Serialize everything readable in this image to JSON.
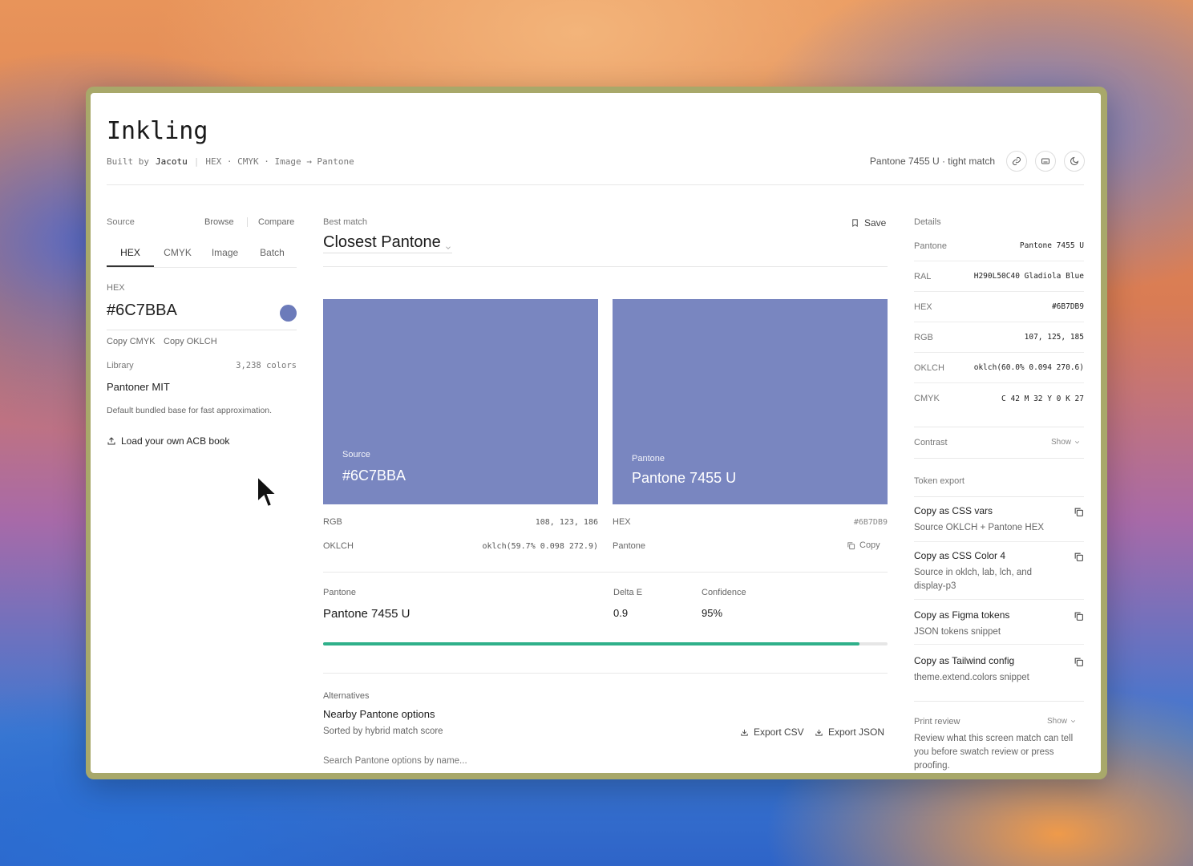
{
  "app": {
    "title": "Inkling",
    "built_by": "Built by",
    "author": "Jacotu",
    "breadcrumb": "HEX · CMYK · Image → Pantone"
  },
  "header": {
    "status": "Pantone 7455 U · tight match",
    "icons": [
      "link-icon",
      "keyboard-icon",
      "moon-icon"
    ]
  },
  "source": {
    "label": "Source",
    "browse": "Browse",
    "compare": "Compare",
    "tabs": [
      "HEX",
      "CMYK",
      "Image",
      "Batch"
    ],
    "hex_label": "HEX",
    "hex_value": "#6C7BBA",
    "hex_color": "#6C7BBA",
    "copy_cmyk": "Copy CMYK",
    "copy_oklch": "Copy OKLCH",
    "library_label": "Library",
    "library_count": "3,238 colors",
    "library_name": "Pantoner MIT",
    "library_desc": "Default bundled base for fast approximation.",
    "load_acb": "Load your own ACB book"
  },
  "match": {
    "best_label": "Best match",
    "heading": "Closest Pantone",
    "save": "Save",
    "source_swatch": {
      "label": "Source",
      "value": "#6C7BBA",
      "color": "#7986C0"
    },
    "pantone_swatch": {
      "label": "Pantone",
      "value": "Pantone 7455 U",
      "color": "#7986C0"
    },
    "rgb_label": "RGB",
    "rgb_value": "108, 123, 186",
    "oklch_label": "OKLCH",
    "oklch_value": "oklch(59.7% 0.098 272.9)",
    "hex_label": "HEX",
    "hex_value": "#6B7DB9",
    "pantone_label": "Pantone",
    "copy": "Copy",
    "result_pantone_label": "Pantone",
    "result_pantone": "Pantone 7455 U",
    "delta_label": "Delta E",
    "delta_value": "0.9",
    "confidence_label": "Confidence",
    "confidence_value": "95%",
    "confidence_fraction": 0.95,
    "bar_color": "#2fb08a",
    "alt_label": "Alternatives",
    "alt_title": "Nearby Pantone options",
    "alt_sub": "Sorted by hybrid match score",
    "export_csv": "Export CSV",
    "export_json": "Export JSON",
    "search_placeholder": "Search Pantone options by name..."
  },
  "details": {
    "label": "Details",
    "rows": [
      {
        "k": "Pantone",
        "v": "Pantone 7455 U"
      },
      {
        "k": "RAL",
        "v": "H290L50C40 Gladiola Blue"
      },
      {
        "k": "HEX",
        "v": "#6B7DB9"
      },
      {
        "k": "RGB",
        "v": "107, 125, 185"
      },
      {
        "k": "OKLCH",
        "v": "oklch(60.0% 0.094 270.6)"
      },
      {
        "k": "CMYK",
        "v": "C 42 M 32 Y 0 K 27"
      }
    ],
    "contrast_label": "Contrast",
    "contrast_show": "Show",
    "token_label": "Token export",
    "tokens": [
      {
        "t": "Copy as CSS vars",
        "d": "Source OKLCH + Pantone HEX"
      },
      {
        "t": "Copy as CSS Color 4",
        "d": "Source in oklch, lab, lch, and display-p3"
      },
      {
        "t": "Copy as Figma tokens",
        "d": "JSON tokens snippet"
      },
      {
        "t": "Copy as Tailwind config",
        "d": "theme.extend.colors snippet"
      }
    ],
    "print_label": "Print review",
    "print_show": "Show",
    "print_desc": "Review what this screen match can tell you before swatch review or press proofing."
  }
}
